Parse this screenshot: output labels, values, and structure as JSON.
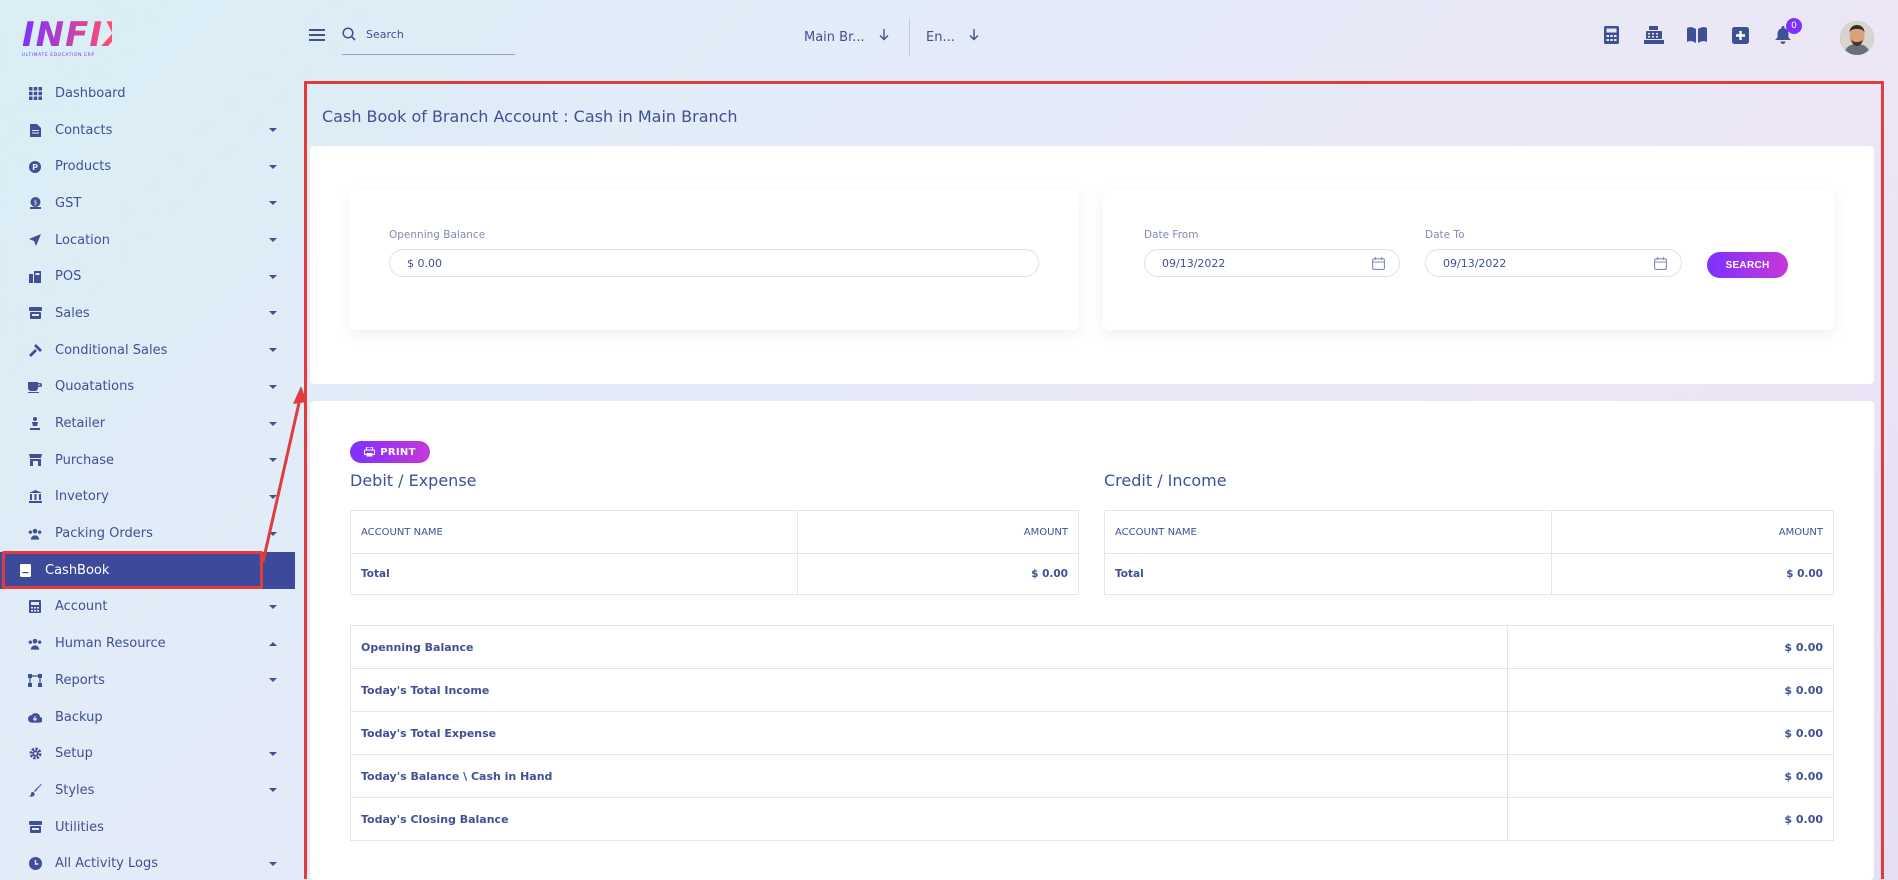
{
  "app": {
    "logo_text": "INFIX",
    "logo_subtitle": "ULTIMATE EDUCATION ERP"
  },
  "sidebar": {
    "items": [
      {
        "label": "Dashboard",
        "icon": "grid-icon",
        "caret": false
      },
      {
        "label": "Contacts",
        "icon": "file-icon",
        "caret": true
      },
      {
        "label": "Products",
        "icon": "product-icon",
        "caret": true
      },
      {
        "label": "GST",
        "icon": "gst-icon",
        "caret": true
      },
      {
        "label": "Location",
        "icon": "location-arrow-icon",
        "caret": true
      },
      {
        "label": "POS",
        "icon": "pos-icon",
        "caret": true
      },
      {
        "label": "Sales",
        "icon": "store-icon",
        "caret": true
      },
      {
        "label": "Conditional Sales",
        "icon": "hammer-icon",
        "caret": true
      },
      {
        "label": "Quoatations",
        "icon": "mug-icon",
        "caret": true
      },
      {
        "label": "Retailer",
        "icon": "retailer-icon",
        "caret": true
      },
      {
        "label": "Purchase",
        "icon": "shop-icon",
        "caret": true
      },
      {
        "label": "Invetory",
        "icon": "bank-icon",
        "caret": true
      },
      {
        "label": "Packing Orders",
        "icon": "users-icon",
        "caret": true
      },
      {
        "label": "CashBook",
        "icon": "book-icon",
        "caret": false,
        "active": true
      },
      {
        "label": "Account",
        "icon": "calculator-icon",
        "caret": true
      },
      {
        "label": "Human Resource",
        "icon": "users-icon",
        "caret": true,
        "caret_up": true
      },
      {
        "label": "Reports",
        "icon": "network-icon",
        "caret": true
      },
      {
        "label": "Backup",
        "icon": "cloud-download-icon",
        "caret": false
      },
      {
        "label": "Setup",
        "icon": "gear-icon",
        "caret": true
      },
      {
        "label": "Styles",
        "icon": "brush-icon",
        "caret": true
      },
      {
        "label": "Utilities",
        "icon": "store-icon",
        "caret": false
      },
      {
        "label": "All Activity Logs",
        "icon": "clock-icon",
        "caret": true
      }
    ]
  },
  "topbar": {
    "search_placeholder": "Search",
    "branch": "Main Br...",
    "language": "En...",
    "notification_count": "0"
  },
  "page": {
    "title": "Cash Book of Branch Account : Cash in Main Branch"
  },
  "filters": {
    "opening_balance_label": "Openning Balance",
    "opening_balance_value": "$ 0.00",
    "date_from_label": "Date From",
    "date_from_value": "09/13/2022",
    "date_to_label": "Date To",
    "date_to_value": "09/13/2022",
    "search_button": "SEARCH"
  },
  "report": {
    "print_button": "PRINT",
    "debit": {
      "title": "Debit / Expense",
      "col_account": "ACCOUNT NAME",
      "col_amount": "AMOUNT",
      "total_label": "Total",
      "total_value": "$ 0.00"
    },
    "credit": {
      "title": "Credit / Income",
      "col_account": "ACCOUNT NAME",
      "col_amount": "AMOUNT",
      "total_label": "Total",
      "total_value": "$ 0.00"
    },
    "summary": [
      {
        "label": "Openning Balance",
        "value": "$ 0.00"
      },
      {
        "label": "Today's Total Income",
        "value": "$ 0.00"
      },
      {
        "label": "Today's Total Expense",
        "value": "$ 0.00"
      },
      {
        "label": "Today's Balance \\ Cash in Hand",
        "value": "$ 0.00"
      },
      {
        "label": "Today's Closing Balance",
        "value": "$ 0.00"
      }
    ]
  },
  "colors": {
    "primary": "#415094",
    "accent_start": "#7c32ff",
    "accent_end": "#c738d8",
    "active_nav": "#3d4a9b",
    "highlight_frame": "#e03c3c"
  }
}
